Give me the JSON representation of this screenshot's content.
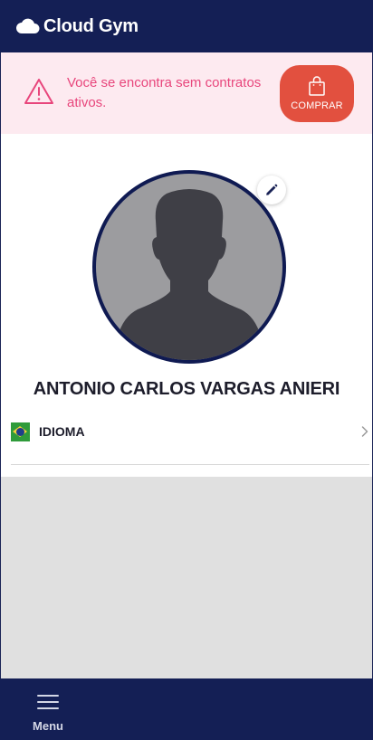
{
  "app": {
    "name": "Cloud Gym",
    "logo_icon": "cloud-icon"
  },
  "alert": {
    "icon": "warning-triangle-icon",
    "message": "Você se encontra sem contratos ativos.",
    "buy_button": {
      "icon": "shopping-bag-icon",
      "label": "COMPRAR"
    }
  },
  "profile": {
    "avatar_icon": "person-silhouette-icon",
    "edit_icon": "pencil-icon",
    "name": "ANTONIO CARLOS VARGAS ANIERI"
  },
  "settings": {
    "language": {
      "flag_icon": "brazil-flag-icon",
      "label": "IDIOMA",
      "chevron_icon": "chevron-right-icon"
    }
  },
  "bottom_nav": {
    "menu": {
      "icon": "hamburger-icon",
      "label": "Menu"
    }
  },
  "colors": {
    "header_bg": "#141f55",
    "alert_bg": "#fdeaf0",
    "alert_text": "#e8467c",
    "buy_button_bg": "#e2503f",
    "content_gray": "#e0e0e0"
  }
}
